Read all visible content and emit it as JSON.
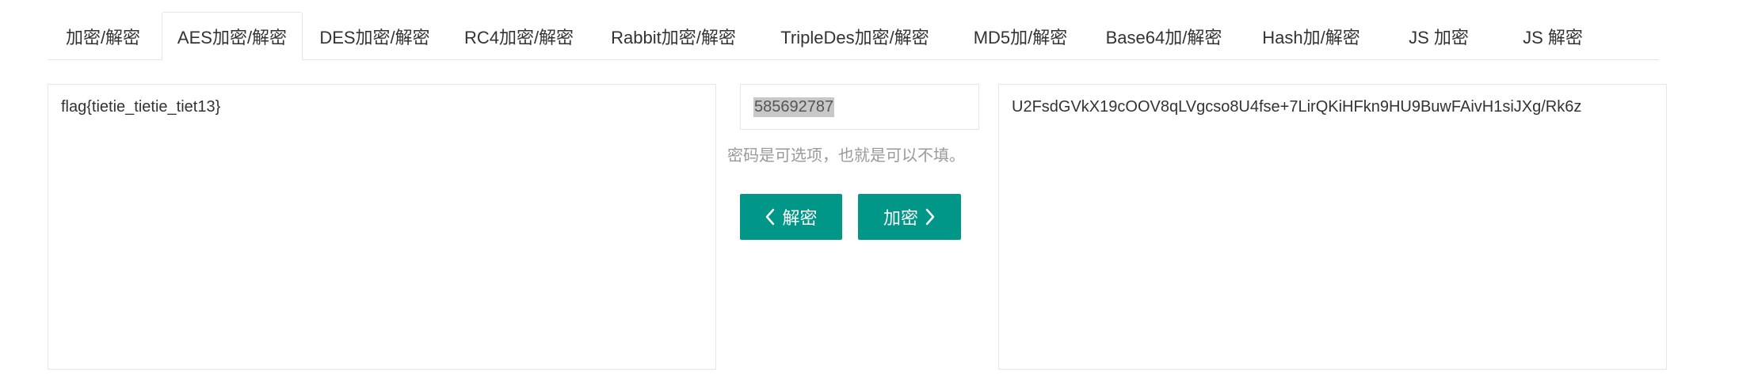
{
  "tabs": [
    {
      "label": "加密/解密"
    },
    {
      "label": "AES加密/解密",
      "active": true
    },
    {
      "label": "DES加密/解密"
    },
    {
      "label": "RC4加密/解密"
    },
    {
      "label": "Rabbit加密/解密"
    },
    {
      "label": "TripleDes加密/解密"
    },
    {
      "label": "MD5加/解密"
    },
    {
      "label": "Base64加/解密"
    },
    {
      "label": "Hash加/解密"
    },
    {
      "label": "JS 加密"
    },
    {
      "label": "JS 解密"
    }
  ],
  "input": {
    "value": "flag{tietie_tietie_tiet13}"
  },
  "password": {
    "value": "585692787",
    "hint": "密码是可选项，也就是可以不填。"
  },
  "buttons": {
    "decrypt_label": "解密",
    "encrypt_label": "加密"
  },
  "output": {
    "value": "U2FsdGVkX19cOOV8qLVgcso8U4fse+7LirQKiHFkn9HU9BuwFAivH1siJXg/Rk6z"
  },
  "colors": {
    "accent": "#009688",
    "border": "#e6e6e6",
    "hint": "#999999"
  },
  "icons": {
    "decrypt": "chevron-left-icon",
    "encrypt": "chevron-right-icon"
  }
}
